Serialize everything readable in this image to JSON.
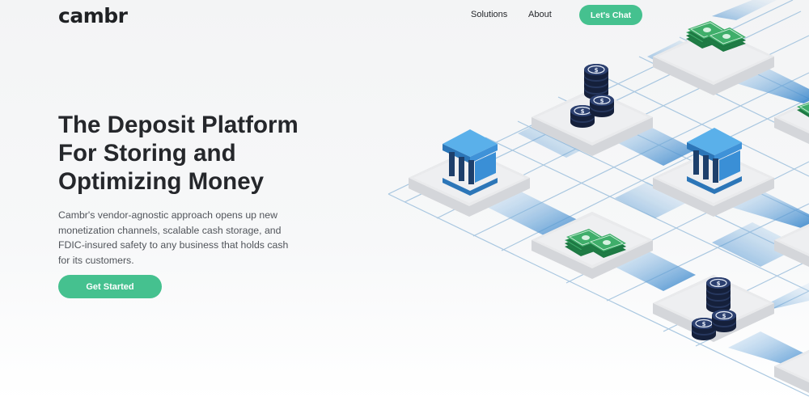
{
  "brand": {
    "name": "cambr"
  },
  "nav": {
    "items": [
      {
        "label": "Solutions"
      },
      {
        "label": "About"
      }
    ],
    "cta_label": "Let's Chat"
  },
  "hero": {
    "title": "The Deposit Platform For Storing and Optimizing Money",
    "description": "Cambr's vendor-agnostic approach opens up new monetization channels, scalable cash storage, and FDIC-insured safety to any business that holds cash for its customers.",
    "cta_label": "Get Started"
  },
  "colors": {
    "accent": "#45c18f",
    "heading": "#25272b",
    "bank_blue": "#3a8fd6",
    "coin_navy": "#1f2f52",
    "cash_green": "#2f9a5a"
  },
  "illustration": {
    "icons": [
      "cash-icon",
      "coin-stack-icon",
      "bank-icon",
      "cash-icon",
      "bank-icon",
      "cash-icon",
      "coin-stack-icon"
    ]
  }
}
